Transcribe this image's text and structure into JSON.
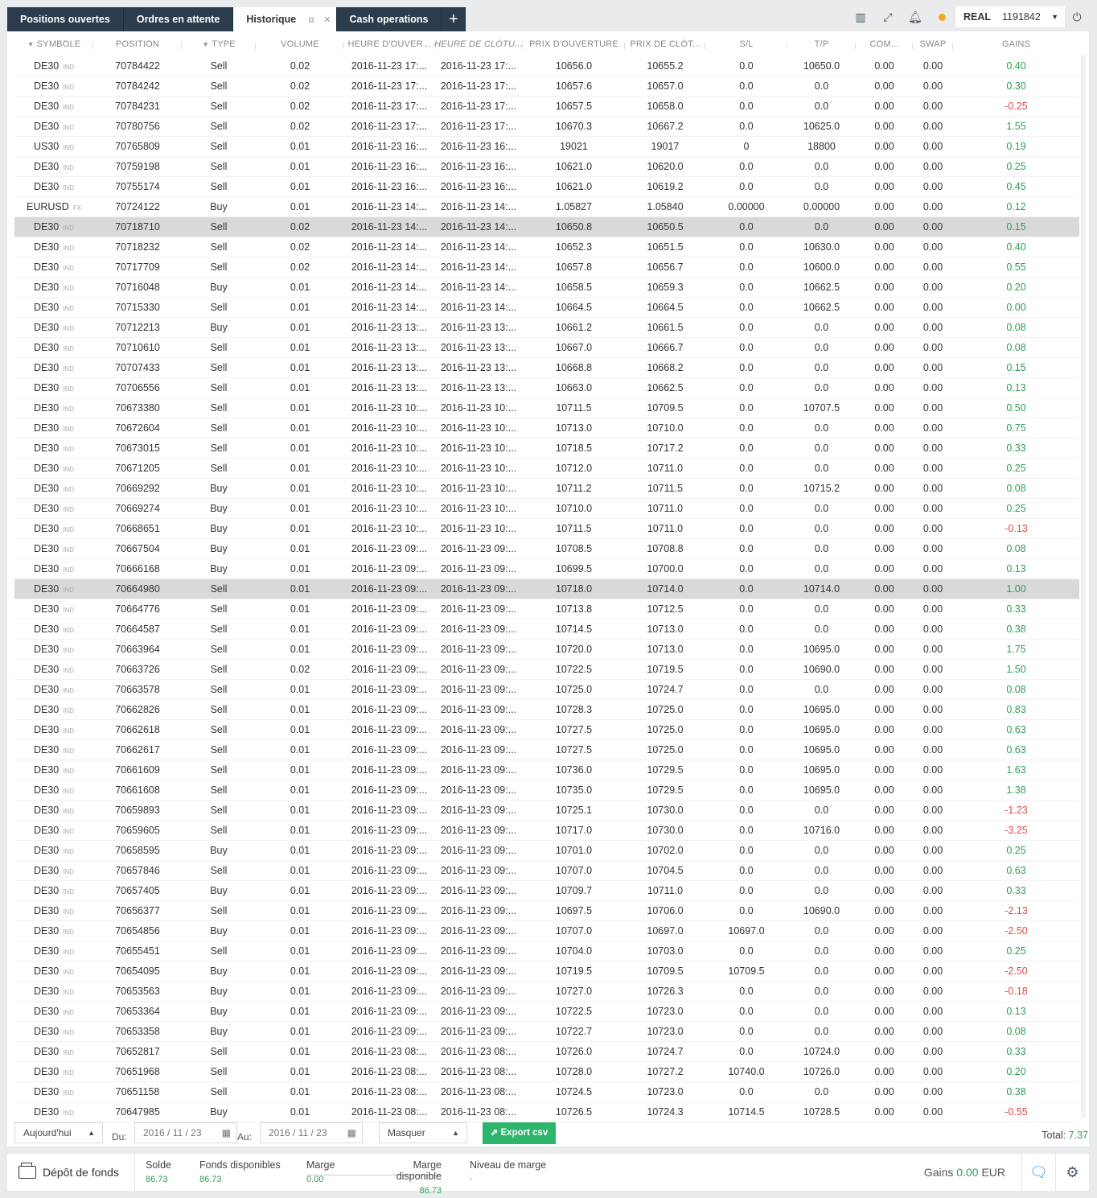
{
  "tabs": [
    {
      "label": "Positions ouvertes",
      "active": false
    },
    {
      "label": "Ordres en attente",
      "active": false
    },
    {
      "label": "Historique",
      "active": true
    },
    {
      "label": "Cash operations",
      "active": false
    }
  ],
  "account": {
    "type": "REAL",
    "number": "1191842",
    "status_color": "#f5a623"
  },
  "columns": [
    "SYMBOLE",
    "POSITION",
    "TYPE",
    "VOLUME",
    "HEURE D'OUVER...",
    "HEURE DE CLÔTU...",
    "PRIX D'OUVERTURE",
    "PRIX DE CLÔT...",
    "S/L",
    "T/P",
    "COM...",
    "SWAP",
    "GAINS"
  ],
  "rows": [
    [
      "DE30",
      "IND",
      "70784422",
      "Sell",
      "0.02",
      "2016-11-23 17:...",
      "2016-11-23 17:...",
      "10656.0",
      "10655.2",
      "0.0",
      "10650.0",
      "0.00",
      "0.00",
      "0.40"
    ],
    [
      "DE30",
      "IND",
      "70784242",
      "Sell",
      "0.02",
      "2016-11-23 17:...",
      "2016-11-23 17:...",
      "10657.6",
      "10657.0",
      "0.0",
      "0.0",
      "0.00",
      "0.00",
      "0.30"
    ],
    [
      "DE30",
      "IND",
      "70784231",
      "Sell",
      "0.02",
      "2016-11-23 17:...",
      "2016-11-23 17:...",
      "10657.5",
      "10658.0",
      "0.0",
      "0.0",
      "0.00",
      "0.00",
      "-0.25"
    ],
    [
      "DE30",
      "IND",
      "70780756",
      "Sell",
      "0.02",
      "2016-11-23 17:...",
      "2016-11-23 17:...",
      "10670.3",
      "10667.2",
      "0.0",
      "10625.0",
      "0.00",
      "0.00",
      "1.55"
    ],
    [
      "US30",
      "IND",
      "70765809",
      "Sell",
      "0.01",
      "2016-11-23 16:...",
      "2016-11-23 16:...",
      "19021",
      "19017",
      "0",
      "18800",
      "0.00",
      "0.00",
      "0.19"
    ],
    [
      "DE30",
      "IND",
      "70759198",
      "Sell",
      "0.01",
      "2016-11-23 16:...",
      "2016-11-23 16:...",
      "10621.0",
      "10620.0",
      "0.0",
      "0.0",
      "0.00",
      "0.00",
      "0.25"
    ],
    [
      "DE30",
      "IND",
      "70755174",
      "Sell",
      "0.01",
      "2016-11-23 16:...",
      "2016-11-23 16:...",
      "10621.0",
      "10619.2",
      "0.0",
      "0.0",
      "0.00",
      "0.00",
      "0.45"
    ],
    [
      "EURUSD",
      "FX",
      "70724122",
      "Buy",
      "0.01",
      "2016-11-23 14:...",
      "2016-11-23 14:...",
      "1.05827",
      "1.05840",
      "0.00000",
      "0.00000",
      "0.00",
      "0.00",
      "0.12"
    ],
    [
      "DE30",
      "IND",
      "70718710",
      "Sell",
      "0.02",
      "2016-11-23 14:...",
      "2016-11-23 14:...",
      "10650.8",
      "10650.5",
      "0.0",
      "0.0",
      "0.00",
      "0.00",
      "0.15"
    ],
    [
      "DE30",
      "IND",
      "70718232",
      "Sell",
      "0.02",
      "2016-11-23 14:...",
      "2016-11-23 14:...",
      "10652.3",
      "10651.5",
      "0.0",
      "10630.0",
      "0.00",
      "0.00",
      "0.40"
    ],
    [
      "DE30",
      "IND",
      "70717709",
      "Sell",
      "0.02",
      "2016-11-23 14:...",
      "2016-11-23 14:...",
      "10657.8",
      "10656.7",
      "0.0",
      "10600.0",
      "0.00",
      "0.00",
      "0.55"
    ],
    [
      "DE30",
      "IND",
      "70716048",
      "Buy",
      "0.01",
      "2016-11-23 14:...",
      "2016-11-23 14:...",
      "10658.5",
      "10659.3",
      "0.0",
      "10662.5",
      "0.00",
      "0.00",
      "0.20"
    ],
    [
      "DE30",
      "IND",
      "70715330",
      "Sell",
      "0.01",
      "2016-11-23 14:...",
      "2016-11-23 14:...",
      "10664.5",
      "10664.5",
      "0.0",
      "10662.5",
      "0.00",
      "0.00",
      "0.00"
    ],
    [
      "DE30",
      "IND",
      "70712213",
      "Buy",
      "0.01",
      "2016-11-23 13:...",
      "2016-11-23 13:...",
      "10661.2",
      "10661.5",
      "0.0",
      "0.0",
      "0.00",
      "0.00",
      "0.08"
    ],
    [
      "DE30",
      "IND",
      "70710610",
      "Sell",
      "0.01",
      "2016-11-23 13:...",
      "2016-11-23 13:...",
      "10667.0",
      "10666.7",
      "0.0",
      "0.0",
      "0.00",
      "0.00",
      "0.08"
    ],
    [
      "DE30",
      "IND",
      "70707433",
      "Sell",
      "0.01",
      "2016-11-23 13:...",
      "2016-11-23 13:...",
      "10668.8",
      "10668.2",
      "0.0",
      "0.0",
      "0.00",
      "0.00",
      "0.15"
    ],
    [
      "DE30",
      "IND",
      "70706556",
      "Sell",
      "0.01",
      "2016-11-23 13:...",
      "2016-11-23 13:...",
      "10663.0",
      "10662.5",
      "0.0",
      "0.0",
      "0.00",
      "0.00",
      "0.13"
    ],
    [
      "DE30",
      "IND",
      "70673380",
      "Sell",
      "0.01",
      "2016-11-23 10:...",
      "2016-11-23 10:...",
      "10711.5",
      "10709.5",
      "0.0",
      "10707.5",
      "0.00",
      "0.00",
      "0.50"
    ],
    [
      "DE30",
      "IND",
      "70672604",
      "Sell",
      "0.01",
      "2016-11-23 10:...",
      "2016-11-23 10:...",
      "10713.0",
      "10710.0",
      "0.0",
      "0.0",
      "0.00",
      "0.00",
      "0.75"
    ],
    [
      "DE30",
      "IND",
      "70673015",
      "Sell",
      "0.01",
      "2016-11-23 10:...",
      "2016-11-23 10:...",
      "10718.5",
      "10717.2",
      "0.0",
      "0.0",
      "0.00",
      "0.00",
      "0.33"
    ],
    [
      "DE30",
      "IND",
      "70671205",
      "Sell",
      "0.01",
      "2016-11-23 10:...",
      "2016-11-23 10:...",
      "10712.0",
      "10711.0",
      "0.0",
      "0.0",
      "0.00",
      "0.00",
      "0.25"
    ],
    [
      "DE30",
      "IND",
      "70669292",
      "Buy",
      "0.01",
      "2016-11-23 10:...",
      "2016-11-23 10:...",
      "10711.2",
      "10711.5",
      "0.0",
      "10715.2",
      "0.00",
      "0.00",
      "0.08"
    ],
    [
      "DE30",
      "IND",
      "70669274",
      "Buy",
      "0.01",
      "2016-11-23 10:...",
      "2016-11-23 10:...",
      "10710.0",
      "10711.0",
      "0.0",
      "0.0",
      "0.00",
      "0.00",
      "0.25"
    ],
    [
      "DE30",
      "IND",
      "70668651",
      "Buy",
      "0.01",
      "2016-11-23 10:...",
      "2016-11-23 10:...",
      "10711.5",
      "10711.0",
      "0.0",
      "0.0",
      "0.00",
      "0.00",
      "-0.13"
    ],
    [
      "DE30",
      "IND",
      "70667504",
      "Buy",
      "0.01",
      "2016-11-23 09:...",
      "2016-11-23 09:...",
      "10708.5",
      "10708.8",
      "0.0",
      "0.0",
      "0.00",
      "0.00",
      "0.08"
    ],
    [
      "DE30",
      "IND",
      "70666168",
      "Buy",
      "0.01",
      "2016-11-23 09:...",
      "2016-11-23 09:...",
      "10699.5",
      "10700.0",
      "0.0",
      "0.0",
      "0.00",
      "0.00",
      "0.13"
    ],
    [
      "DE30",
      "IND",
      "70664980",
      "Sell",
      "0.01",
      "2016-11-23 09:...",
      "2016-11-23 09:...",
      "10718.0",
      "10714.0",
      "0.0",
      "10714.0",
      "0.00",
      "0.00",
      "1.00"
    ],
    [
      "DE30",
      "IND",
      "70664776",
      "Sell",
      "0.01",
      "2016-11-23 09:...",
      "2016-11-23 09:...",
      "10713.8",
      "10712.5",
      "0.0",
      "0.0",
      "0.00",
      "0.00",
      "0.33"
    ],
    [
      "DE30",
      "IND",
      "70664587",
      "Sell",
      "0.01",
      "2016-11-23 09:...",
      "2016-11-23 09:...",
      "10714.5",
      "10713.0",
      "0.0",
      "0.0",
      "0.00",
      "0.00",
      "0.38"
    ],
    [
      "DE30",
      "IND",
      "70663964",
      "Sell",
      "0.01",
      "2016-11-23 09:...",
      "2016-11-23 09:...",
      "10720.0",
      "10713.0",
      "0.0",
      "10695.0",
      "0.00",
      "0.00",
      "1.75"
    ],
    [
      "DE30",
      "IND",
      "70663726",
      "Sell",
      "0.02",
      "2016-11-23 09:...",
      "2016-11-23 09:...",
      "10722.5",
      "10719.5",
      "0.0",
      "10690.0",
      "0.00",
      "0.00",
      "1.50"
    ],
    [
      "DE30",
      "IND",
      "70663578",
      "Sell",
      "0.01",
      "2016-11-23 09:...",
      "2016-11-23 09:...",
      "10725.0",
      "10724.7",
      "0.0",
      "0.0",
      "0.00",
      "0.00",
      "0.08"
    ],
    [
      "DE30",
      "IND",
      "70662826",
      "Sell",
      "0.01",
      "2016-11-23 09:...",
      "2016-11-23 09:...",
      "10728.3",
      "10725.0",
      "0.0",
      "10695.0",
      "0.00",
      "0.00",
      "0.83"
    ],
    [
      "DE30",
      "IND",
      "70662618",
      "Sell",
      "0.01",
      "2016-11-23 09:...",
      "2016-11-23 09:...",
      "10727.5",
      "10725.0",
      "0.0",
      "10695.0",
      "0.00",
      "0.00",
      "0.63"
    ],
    [
      "DE30",
      "IND",
      "70662617",
      "Sell",
      "0.01",
      "2016-11-23 09:...",
      "2016-11-23 09:...",
      "10727.5",
      "10725.0",
      "0.0",
      "10695.0",
      "0.00",
      "0.00",
      "0.63"
    ],
    [
      "DE30",
      "IND",
      "70661609",
      "Sell",
      "0.01",
      "2016-11-23 09:...",
      "2016-11-23 09:...",
      "10736.0",
      "10729.5",
      "0.0",
      "10695.0",
      "0.00",
      "0.00",
      "1.63"
    ],
    [
      "DE30",
      "IND",
      "70661608",
      "Sell",
      "0.01",
      "2016-11-23 09:...",
      "2016-11-23 09:...",
      "10735.0",
      "10729.5",
      "0.0",
      "10695.0",
      "0.00",
      "0.00",
      "1.38"
    ],
    [
      "DE30",
      "IND",
      "70659893",
      "Sell",
      "0.01",
      "2016-11-23 09:...",
      "2016-11-23 09:...",
      "10725.1",
      "10730.0",
      "0.0",
      "0.0",
      "0.00",
      "0.00",
      "-1.23"
    ],
    [
      "DE30",
      "IND",
      "70659605",
      "Sell",
      "0.01",
      "2016-11-23 09:...",
      "2016-11-23 09:...",
      "10717.0",
      "10730.0",
      "0.0",
      "10716.0",
      "0.00",
      "0.00",
      "-3.25"
    ],
    [
      "DE30",
      "IND",
      "70658595",
      "Buy",
      "0.01",
      "2016-11-23 09:...",
      "2016-11-23 09:...",
      "10701.0",
      "10702.0",
      "0.0",
      "0.0",
      "0.00",
      "0.00",
      "0.25"
    ],
    [
      "DE30",
      "IND",
      "70657846",
      "Sell",
      "0.01",
      "2016-11-23 09:...",
      "2016-11-23 09:...",
      "10707.0",
      "10704.5",
      "0.0",
      "0.0",
      "0.00",
      "0.00",
      "0.63"
    ],
    [
      "DE30",
      "IND",
      "70657405",
      "Buy",
      "0.01",
      "2016-11-23 09:...",
      "2016-11-23 09:...",
      "10709.7",
      "10711.0",
      "0.0",
      "0.0",
      "0.00",
      "0.00",
      "0.33"
    ],
    [
      "DE30",
      "IND",
      "70656377",
      "Sell",
      "0.01",
      "2016-11-23 09:...",
      "2016-11-23 09:...",
      "10697.5",
      "10706.0",
      "0.0",
      "10690.0",
      "0.00",
      "0.00",
      "-2.13"
    ],
    [
      "DE30",
      "IND",
      "70654856",
      "Buy",
      "0.01",
      "2016-11-23 09:...",
      "2016-11-23 09:...",
      "10707.0",
      "10697.0",
      "10697.0",
      "0.0",
      "0.00",
      "0.00",
      "-2.50"
    ],
    [
      "DE30",
      "IND",
      "70655451",
      "Sell",
      "0.01",
      "2016-11-23 09:...",
      "2016-11-23 09:...",
      "10704.0",
      "10703.0",
      "0.0",
      "0.0",
      "0.00",
      "0.00",
      "0.25"
    ],
    [
      "DE30",
      "IND",
      "70654095",
      "Buy",
      "0.01",
      "2016-11-23 09:...",
      "2016-11-23 09:...",
      "10719.5",
      "10709.5",
      "10709.5",
      "0.0",
      "0.00",
      "0.00",
      "-2.50"
    ],
    [
      "DE30",
      "IND",
      "70653563",
      "Buy",
      "0.01",
      "2016-11-23 09:...",
      "2016-11-23 09:...",
      "10727.0",
      "10726.3",
      "0.0",
      "0.0",
      "0.00",
      "0.00",
      "-0.18"
    ],
    [
      "DE30",
      "IND",
      "70653364",
      "Buy",
      "0.01",
      "2016-11-23 09:...",
      "2016-11-23 09:...",
      "10722.5",
      "10723.0",
      "0.0",
      "0.0",
      "0.00",
      "0.00",
      "0.13"
    ],
    [
      "DE30",
      "IND",
      "70653358",
      "Buy",
      "0.01",
      "2016-11-23 09:...",
      "2016-11-23 09:...",
      "10722.7",
      "10723.0",
      "0.0",
      "0.0",
      "0.00",
      "0.00",
      "0.08"
    ],
    [
      "DE30",
      "IND",
      "70652817",
      "Sell",
      "0.01",
      "2016-11-23 08:...",
      "2016-11-23 08:...",
      "10726.0",
      "10724.7",
      "0.0",
      "10724.0",
      "0.00",
      "0.00",
      "0.33"
    ],
    [
      "DE30",
      "IND",
      "70651968",
      "Sell",
      "0.01",
      "2016-11-23 08:...",
      "2016-11-23 08:...",
      "10728.0",
      "10727.2",
      "10740.0",
      "10726.0",
      "0.00",
      "0.00",
      "0.20"
    ],
    [
      "DE30",
      "IND",
      "70651158",
      "Sell",
      "0.01",
      "2016-11-23 08:...",
      "2016-11-23 08:...",
      "10724.5",
      "10723.0",
      "0.0",
      "0.0",
      "0.00",
      "0.00",
      "0.38"
    ],
    [
      "DE30",
      "IND",
      "70647985",
      "Buy",
      "0.01",
      "2016-11-23 08:...",
      "2016-11-23 08:...",
      "10726.5",
      "10724.3",
      "10714.5",
      "10728.5",
      "0.00",
      "0.00",
      "-0.55"
    ]
  ],
  "selected_rows": [
    8,
    26
  ],
  "filters": {
    "period": "Aujourd'hui",
    "from_label": "Du:",
    "from_date": "2016 / 11 / 23",
    "to_label": "Au:",
    "to_date": "2016 / 11 / 23",
    "mask": "Masquer",
    "export_label": "Export csv",
    "total_label": "Total:",
    "total_value": "7.37"
  },
  "footer": {
    "deposit": "Dépôt de fonds",
    "solde_label": "Solde",
    "solde_value": "86.73",
    "fonds_label": "Fonds disponibles",
    "fonds_value": "86.73",
    "marge_label": "Marge",
    "marge_value": "0.00",
    "marge_dispo_label": "Marge disponible",
    "marge_dispo_value": "86.73",
    "niveau_label": "Niveau de marge",
    "niveau_value": "-",
    "gains_label": "Gains",
    "gains_value": "0.00",
    "gains_currency": "EUR"
  },
  "colors": {
    "accent_green": "#2db56b",
    "gain_positive": "#2e9e55",
    "gain_negative": "#e04848",
    "tab_bg": "#2b3c4d"
  }
}
